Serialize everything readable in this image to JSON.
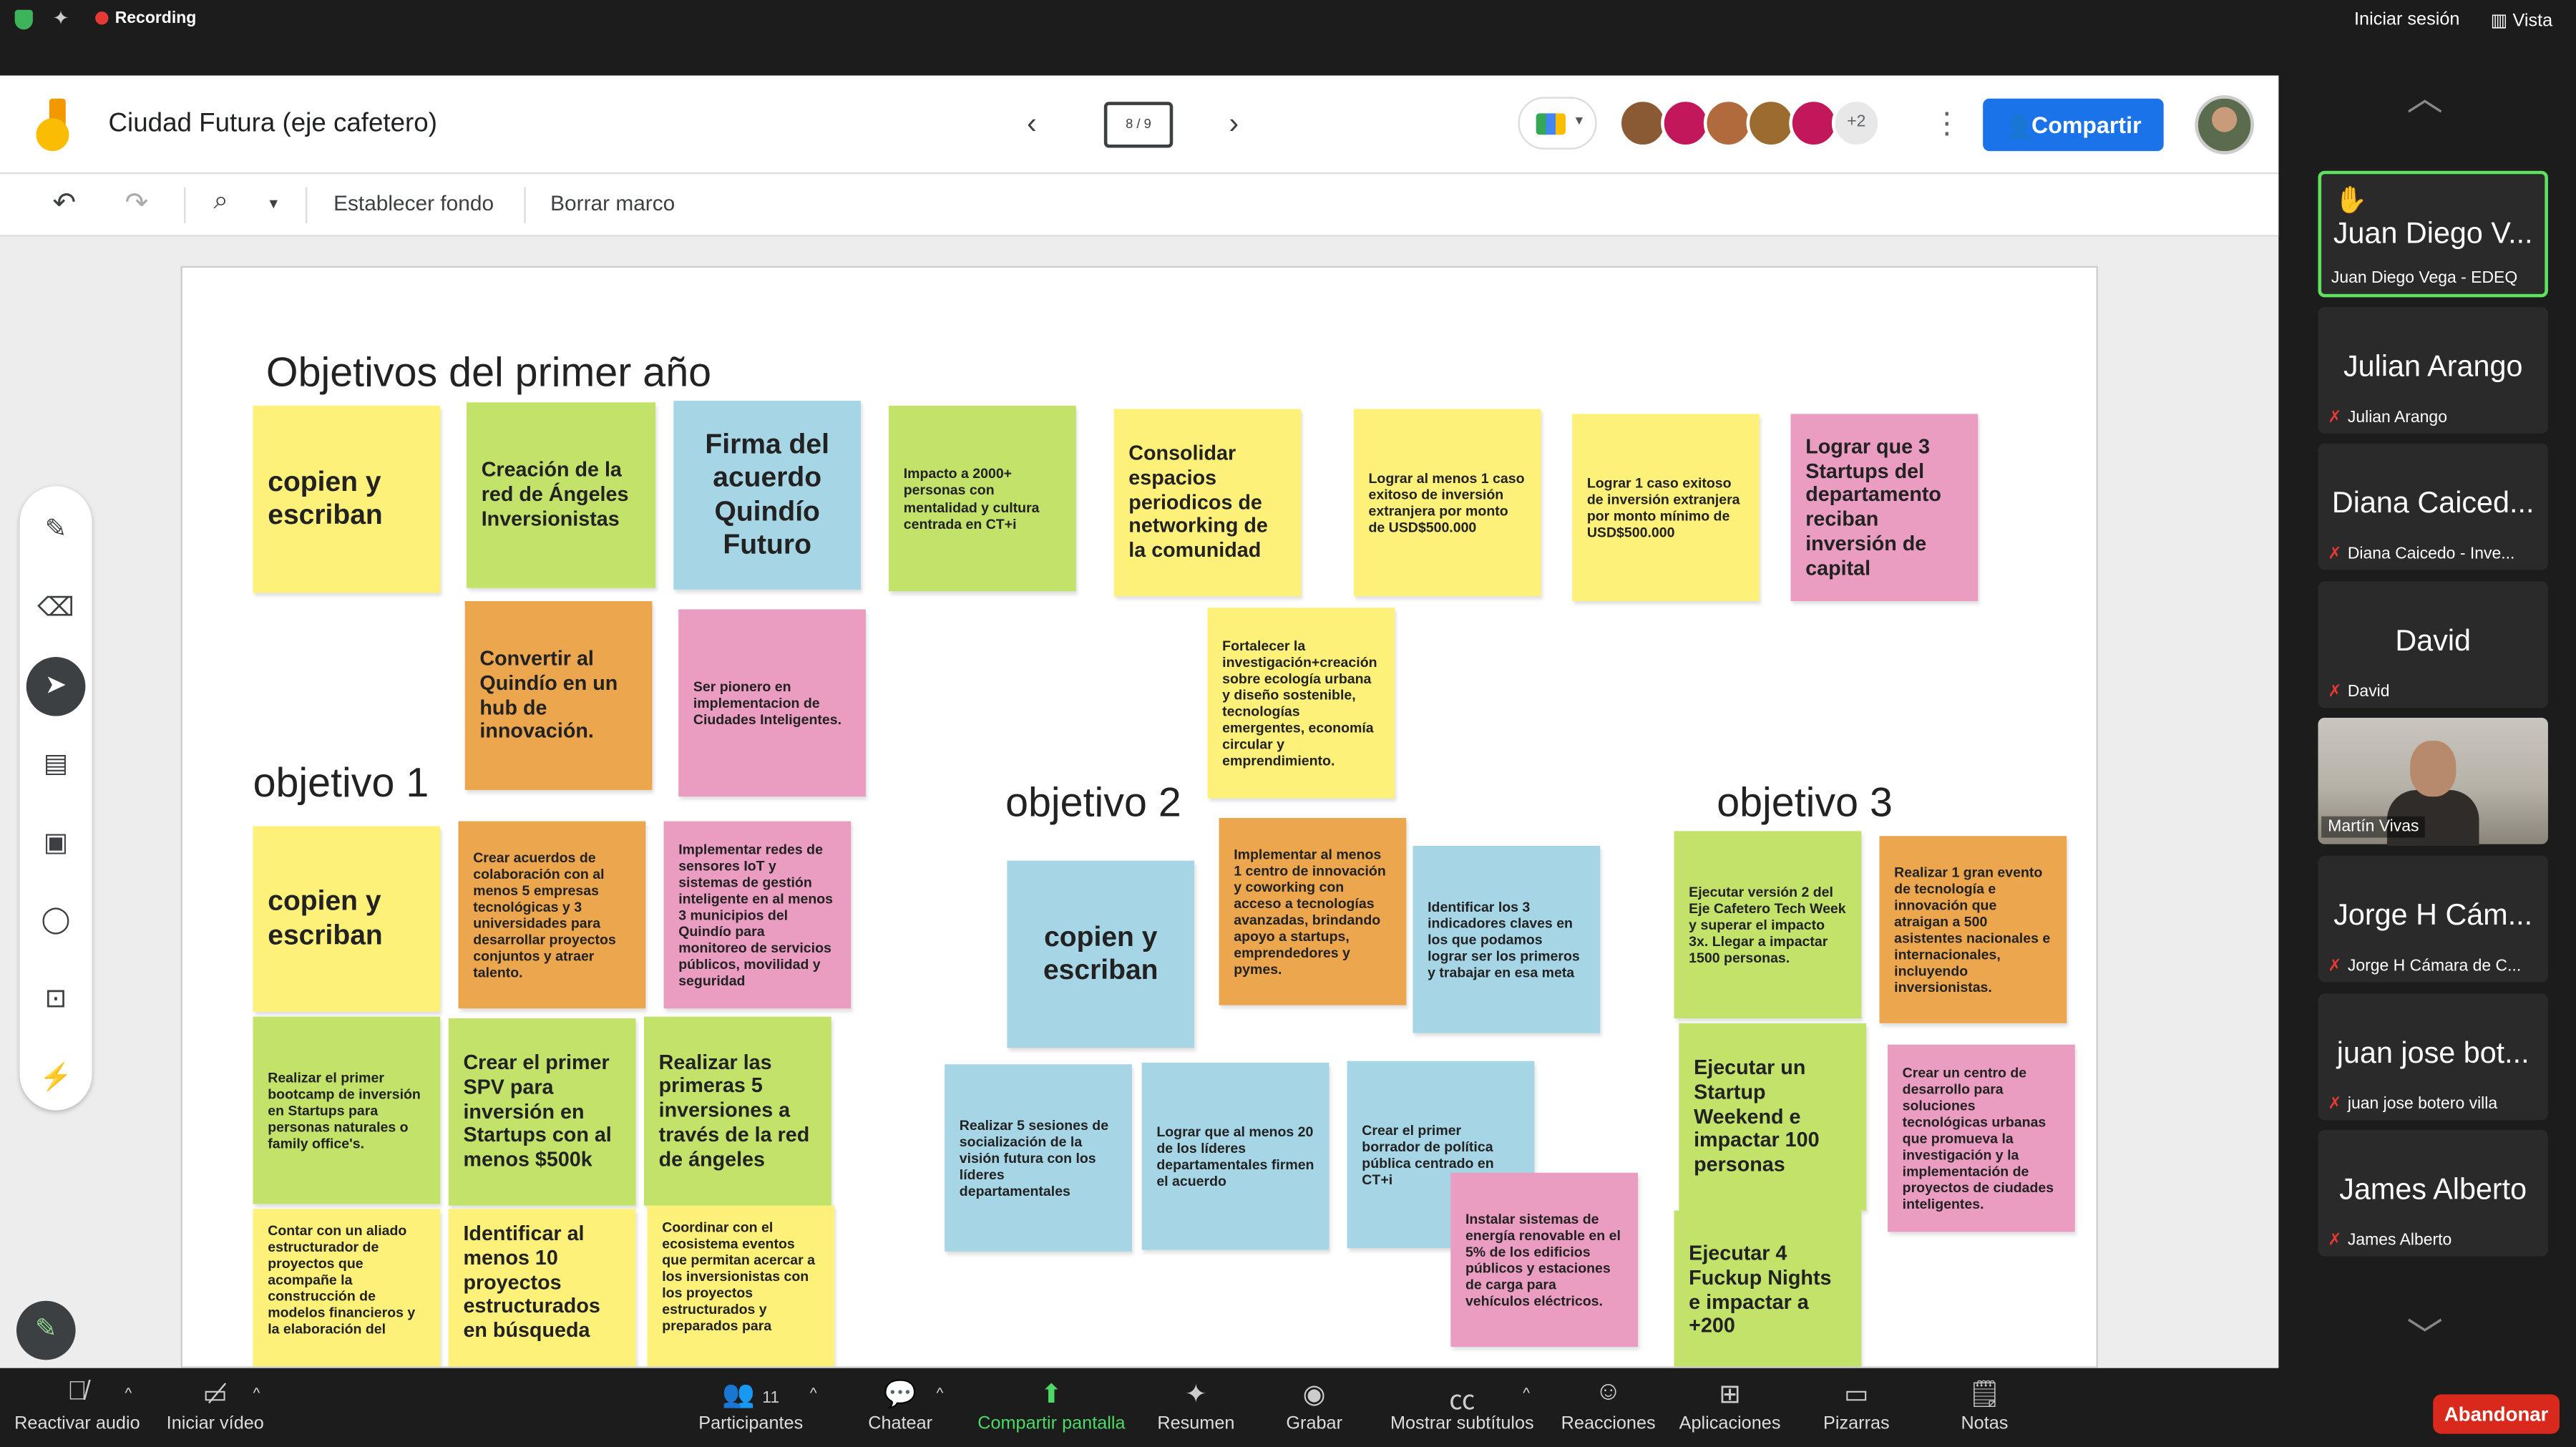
{
  "topbar": {
    "recording": "Recording",
    "signin": "Iniciar sesión",
    "view": "Vista"
  },
  "header": {
    "title": "Ciudad Futura (eje cafetero)",
    "frame_indicator": "8 / 9",
    "extra_count": "+2",
    "share_label": "Compartir"
  },
  "toolbar": {
    "set_background": "Establecer fondo",
    "clear_frame": "Borrar marco"
  },
  "colors": {
    "yellow": "#fdf17a",
    "green": "#c2e26a",
    "blue": "#a6d6e6",
    "orange": "#eba64e",
    "pink": "#ea9cc1",
    "share": "#1a73e8",
    "leave": "#d9291c"
  },
  "board": {
    "headings": [
      "Objetivos del primer año",
      "objetivo 1",
      "objetivo 2",
      "objetivo 3"
    ],
    "notes": [
      "copien y escriban",
      "Creación de la red de Ángeles Inversionistas",
      "Firma del acuerdo Quindío Futuro",
      "Impacto a 2000+ personas con mentalidad y cultura centrada en CT+i",
      "Consolidar espacios periodicos de networking de la comunidad",
      "Lograr al menos 1 caso exitoso de inversión extranjera por monto de USD$500.000",
      "Lograr 1 caso exitoso de inversión extranjera por monto mínimo de USD$500.000",
      "Lograr que 3 Startups del departamento reciban inversión de capital",
      "Convertir al Quindío en un hub de innovación.",
      "Ser pionero en implementacion de Ciudades Inteligentes.",
      "Fortalecer la investigación+creación sobre ecología urbana y diseño sostenible, tecnologías emergentes, economía circular y emprendimiento.",
      "copien y escriban",
      "Crear acuerdos de colaboración con al menos 5 empresas tecnológicas y 3 universidades para desarrollar proyectos conjuntos y atraer talento.",
      "Implementar redes de sensores IoT y sistemas de gestión inteligente en al menos 3 municipios del Quindío para monitoreo de servicios públicos, movilidad y seguridad",
      "Realizar el primer bootcamp de inversión en Startups para personas naturales o family office's.",
      "Crear el primer SPV para inversión en Startups con al menos $500k",
      "Realizar las primeras 5 inversiones a través de la red de ángeles",
      "Contar con un aliado estructurador de proyectos que acompañe la construcción de modelos financieros y la elaboración del",
      "Identificar al menos 10 proyectos estructurados en búsqueda",
      "Coordinar con el ecosistema eventos que permitan acercar a los inversionistas con los proyectos estructurados y preparados para",
      "copien y escriban",
      "Implementar al menos 1 centro de innovación y coworking con acceso a tecnologías avanzadas, brindando apoyo a startups, emprendedores y pymes.",
      "Identificar los 3 indicadores claves en los que podamos lograr ser los primeros y trabajar en esa meta",
      "Realizar 5 sesiones de socialización de la visión futura con los líderes departamentales",
      "Lograr que al menos 20 de los líderes departamentales firmen el acuerdo",
      "Crear el primer borrador de política pública centrado en CT+i",
      "Instalar sistemas de energía renovable en el 5% de los edificios públicos y estaciones de carga para vehículos eléctricos.",
      "Ejecutar versión 2 del Eje Cafetero Tech Week y superar el impacto 3x. Llegar a impactar 1500 personas.",
      "Realizar 1 gran evento de tecnología e innovación que atraigan a 500 asistentes nacionales e internacionales, incluyendo inversionistas.",
      "Ejecutar un Startup Weekend e impactar 100 personas",
      "Crear un centro de desarrollo para soluciones tecnológicas urbanas que promueva la investigación y la implementación de proyectos de ciudades inteligentes.",
      "Ejecutar 4 Fuckup Nights e impactar a +200"
    ]
  },
  "participants": [
    {
      "big": "Juan Diego V...",
      "small": "Juan Diego Vega - EDEQ"
    },
    {
      "big": "Julian Arango",
      "small": "Julian Arango"
    },
    {
      "big": "Diana Caiced...",
      "small": "Diana Caicedo - Inve..."
    },
    {
      "big": "David",
      "small": "David"
    },
    {
      "big": "",
      "small": "Martín Vivas"
    },
    {
      "big": "Jorge H Cám...",
      "small": "Jorge H Cámara de C..."
    },
    {
      "big": "juan jose bot...",
      "small": "juan jose botero villa"
    },
    {
      "big": "James Alberto",
      "small": "James Alberto"
    }
  ],
  "bottombar": {
    "audio": "Reactivar audio",
    "video": "Iniciar vídeo",
    "participants_count": "11",
    "participants": "Participantes",
    "chat": "Chatear",
    "share": "Compartir pantalla",
    "summary": "Resumen",
    "record": "Grabar",
    "subtitles": "Mostrar subtítulos",
    "reactions": "Reacciones",
    "apps": "Aplicaciones",
    "whiteboards": "Pizarras",
    "notes": "Notas",
    "leave": "Abandonar"
  }
}
